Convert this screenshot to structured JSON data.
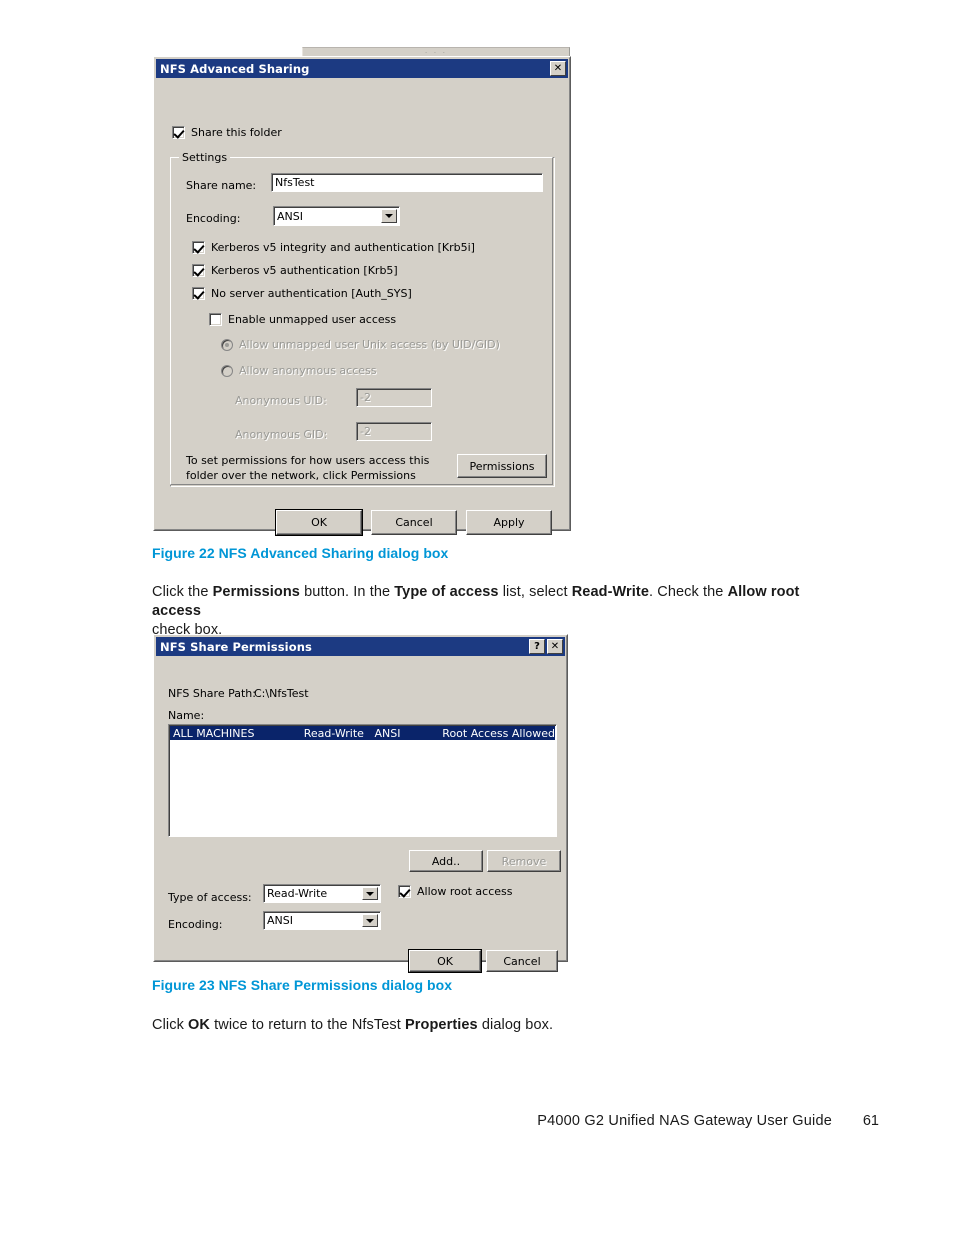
{
  "page": {
    "footer_title": "P4000 G2 Unified NAS Gateway User Guide",
    "footer_page": "61"
  },
  "figure22": {
    "caption": "Figure 22 NFS Advanced Sharing dialog box",
    "dialog": {
      "title": "NFS Advanced Sharing",
      "close_label": "✕",
      "share_this_folder": {
        "label": "Share this folder",
        "checked": true
      },
      "settings_group": {
        "title": "Settings",
        "share_name_label": "Share name:",
        "share_name_value": "NfsTest",
        "encoding_label": "Encoding:",
        "encoding_value": "ANSI",
        "security_options": [
          {
            "label": "Kerberos v5 integrity and authentication [Krb5i]",
            "checked": true
          },
          {
            "label": "Kerberos v5 authentication [Krb5]",
            "checked": true
          },
          {
            "label": "No server authentication [Auth_SYS]",
            "checked": true
          }
        ],
        "enable_unmapped": {
          "label": "Enable unmapped user access",
          "checked": false
        },
        "unmapped_radios": [
          {
            "label": "Allow unmapped user Unix access (by UID/GID)",
            "selected": true,
            "disabled": true
          },
          {
            "label": "Allow anonymous access",
            "selected": false,
            "disabled": true
          }
        ],
        "anon_uid_label": "Anonymous UID:",
        "anon_uid_value": "-2",
        "anon_gid_label": "Anonymous GID:",
        "anon_gid_value": "-2",
        "permissions_hint_line1": "To set permissions for how users access this",
        "permissions_hint_line2": "folder over the network, click Permissions",
        "permissions_button": "Permissions"
      },
      "buttons": {
        "ok": "OK",
        "cancel": "Cancel",
        "apply": "Apply"
      }
    }
  },
  "body_text_1": {
    "seg1": "Click the ",
    "bold1": "Permissions",
    "seg2": " button. In the ",
    "bold2": "Type of access",
    "seg3": " list, select ",
    "bold3": "Read-Write",
    "seg4": ". Check the ",
    "bold4": "Allow root access",
    "seg5": "check box."
  },
  "figure23": {
    "caption": "Figure 23 NFS Share Permissions dialog box",
    "dialog": {
      "title": "NFS Share Permissions",
      "help_label": "?",
      "close_label": "✕",
      "share_path_label": "NFS Share Path:",
      "share_path_value": "C:\\NfsTest",
      "name_label": "Name:",
      "list_rows": [
        {
          "machine": "ALL MACHINES",
          "access": "Read-Write",
          "encoding": "ANSI",
          "root": "Root Access Allowed"
        }
      ],
      "add_button": "Add..",
      "remove_button": "Remove",
      "type_of_access_label": "Type of access:",
      "type_of_access_value": "Read-Write",
      "allow_root_access": {
        "label": "Allow root access",
        "checked": true
      },
      "encoding_label": "Encoding:",
      "encoding_value": "ANSI",
      "buttons": {
        "ok": "OK",
        "cancel": "Cancel"
      }
    }
  },
  "body_text_2": {
    "seg1": "Click ",
    "bold1": "OK",
    "seg2": " twice to return to the NfsTest ",
    "bold2": "Properties",
    "seg3": " dialog box."
  },
  "colors": {
    "caption_blue": "#0096d6",
    "titlebar_navy": "#1c3a82",
    "dialog_face": "#d4d0c8",
    "selection_navy": "#0a246a"
  }
}
